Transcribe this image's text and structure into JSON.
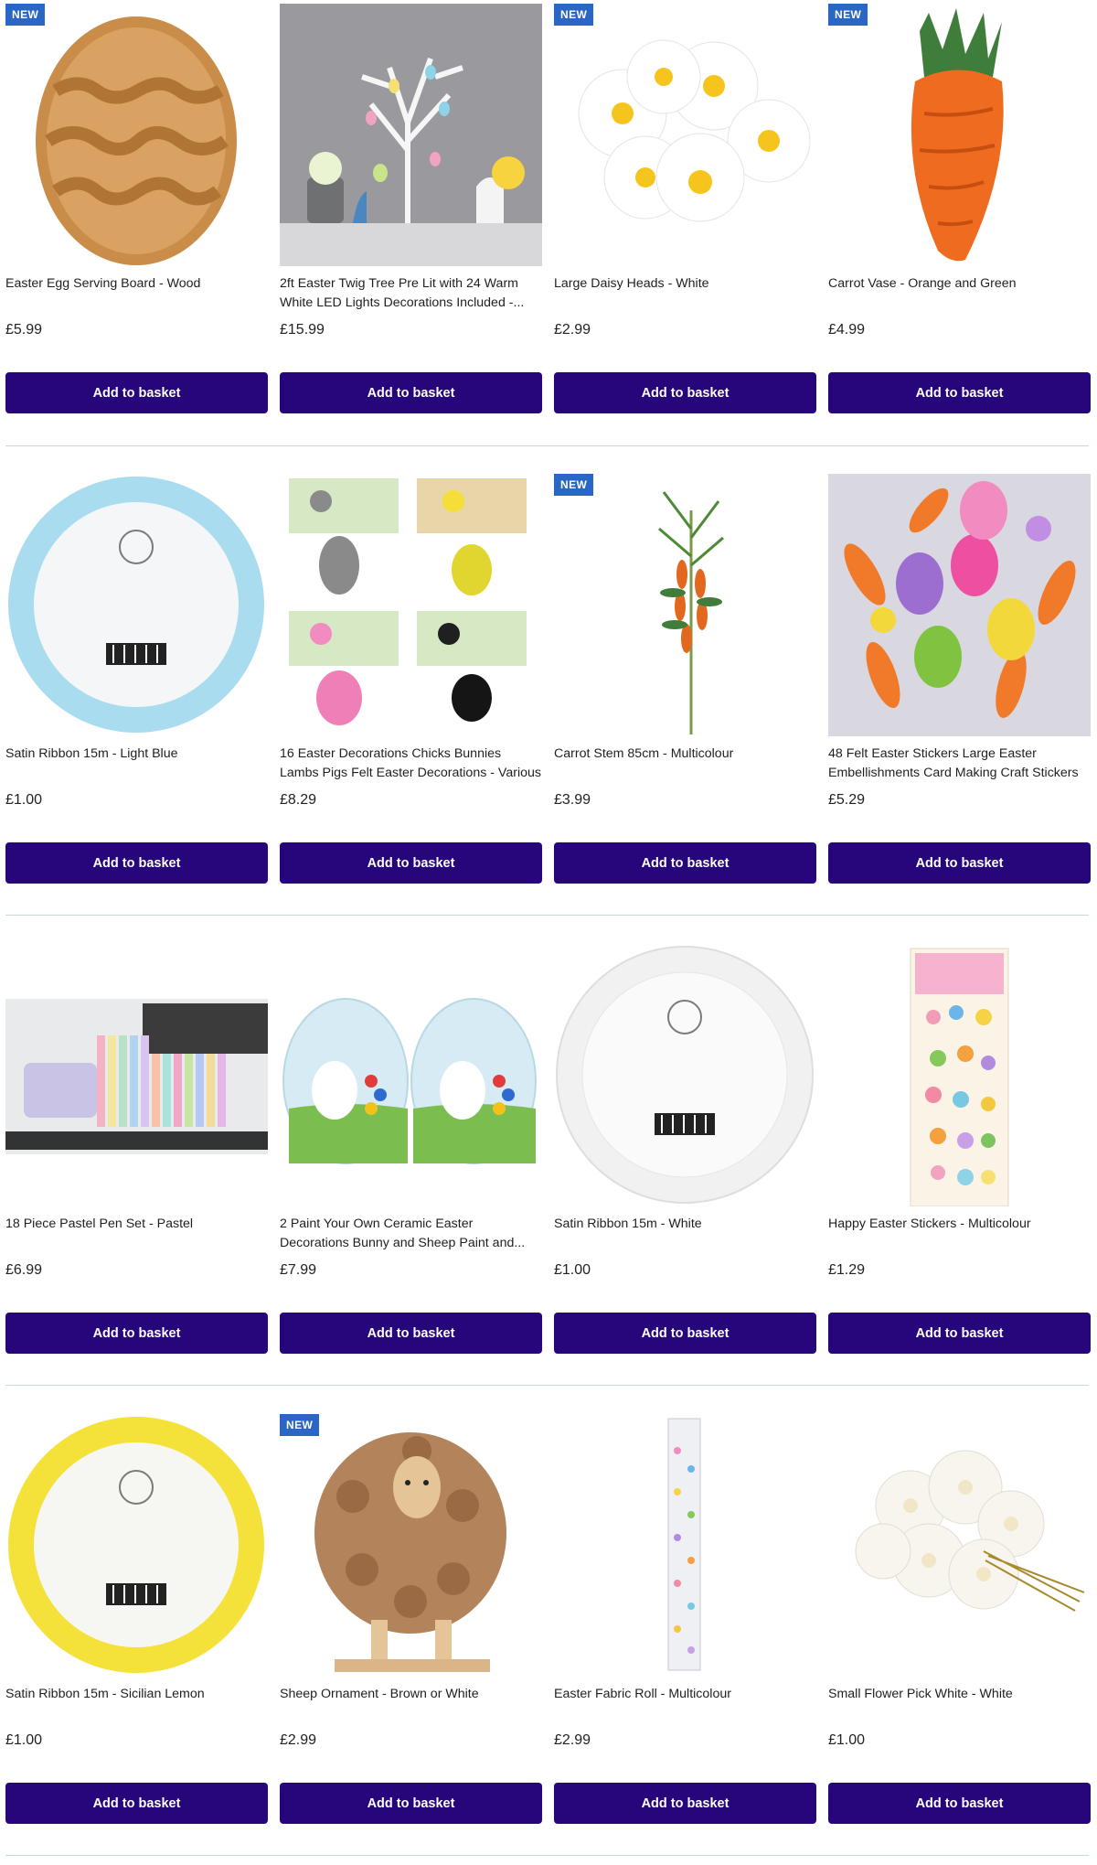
{
  "colors": {
    "button_bg": "#26067a",
    "button_text": "#ffffff",
    "badge_bg": "#2a66c6",
    "divider": "#c6dcda"
  },
  "button_label": "Add to basket",
  "badge_label": "NEW",
  "rows": [
    {
      "products": [
        {
          "title": "Easter Egg Serving Board - Wood",
          "price": "£5.99",
          "is_new": true,
          "image": "egg-board-image"
        },
        {
          "title": "2ft Easter Twig Tree Pre Lit with 24 Warm White LED Lights Decorations Included -...",
          "price": "£15.99",
          "is_new": false,
          "image": "twig-tree-image"
        },
        {
          "title": "Large Daisy Heads - White",
          "price": "£2.99",
          "is_new": true,
          "image": "daisy-heads-image"
        },
        {
          "title": "Carrot Vase - Orange and Green",
          "price": "£4.99",
          "is_new": true,
          "image": "carrot-vase-image"
        }
      ]
    },
    {
      "products": [
        {
          "title": "Satin Ribbon 15m - Light Blue",
          "price": "£1.00",
          "is_new": false,
          "image": "ribbon-blue-image"
        },
        {
          "title": "16 Easter Decorations Chicks Bunnies Lambs Pigs Felt Easter Decorations - Various",
          "price": "£8.29",
          "is_new": false,
          "image": "felt-decorations-image"
        },
        {
          "title": "Carrot Stem 85cm - Multicolour",
          "price": "£3.99",
          "is_new": true,
          "image": "carrot-stem-image"
        },
        {
          "title": "48 Felt Easter Stickers Large Easter Embellishments Card Making Craft Stickers ...",
          "price": "£5.29",
          "is_new": false,
          "image": "felt-stickers-image"
        }
      ]
    },
    {
      "products": [
        {
          "title": "18 Piece Pastel Pen Set - Pastel",
          "price": "£6.99",
          "is_new": false,
          "image": "pastel-pen-image"
        },
        {
          "title": "2 Paint Your Own Ceramic Easter Decorations Bunny and Sheep Paint and...",
          "price": "£7.99",
          "is_new": false,
          "image": "paint-ceramic-image"
        },
        {
          "title": "Satin Ribbon 15m - White",
          "price": "£1.00",
          "is_new": false,
          "image": "ribbon-white-image"
        },
        {
          "title": "Happy Easter Stickers - Multicolour",
          "price": "£1.29",
          "is_new": false,
          "image": "easter-stickers-image"
        }
      ]
    },
    {
      "products": [
        {
          "title": "Satin Ribbon 15m - Sicilian Lemon",
          "price": "£1.00",
          "is_new": false,
          "image": "ribbon-yellow-image"
        },
        {
          "title": "Sheep Ornament - Brown or White",
          "price": "£2.99",
          "is_new": true,
          "image": "sheep-ornament-image"
        },
        {
          "title": "Easter Fabric Roll - Multicolour",
          "price": "£2.99",
          "is_new": false,
          "image": "fabric-roll-image"
        },
        {
          "title": "Small Flower Pick White - White",
          "price": "£1.00",
          "is_new": false,
          "image": "flower-pick-image"
        }
      ]
    }
  ]
}
